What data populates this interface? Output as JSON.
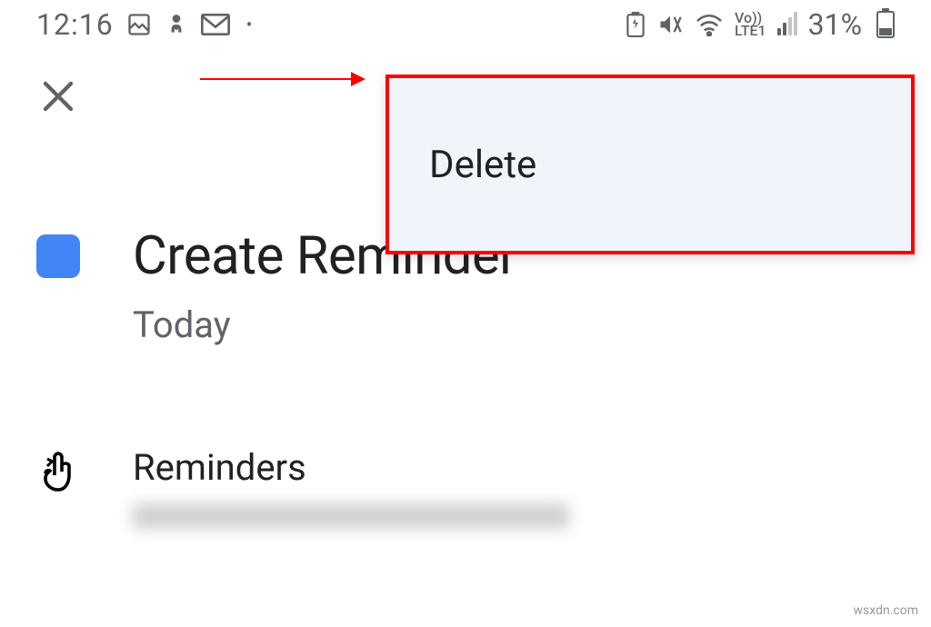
{
  "statusBar": {
    "time": "12:16",
    "battery": "31%",
    "networkLabel1": "Vo))",
    "networkLabel2": "LTE1"
  },
  "menu": {
    "delete": "Delete"
  },
  "reminder": {
    "title": "Create Reminder",
    "date": "Today"
  },
  "account": {
    "label": "Reminders"
  },
  "watermark": "wsxdn.com"
}
